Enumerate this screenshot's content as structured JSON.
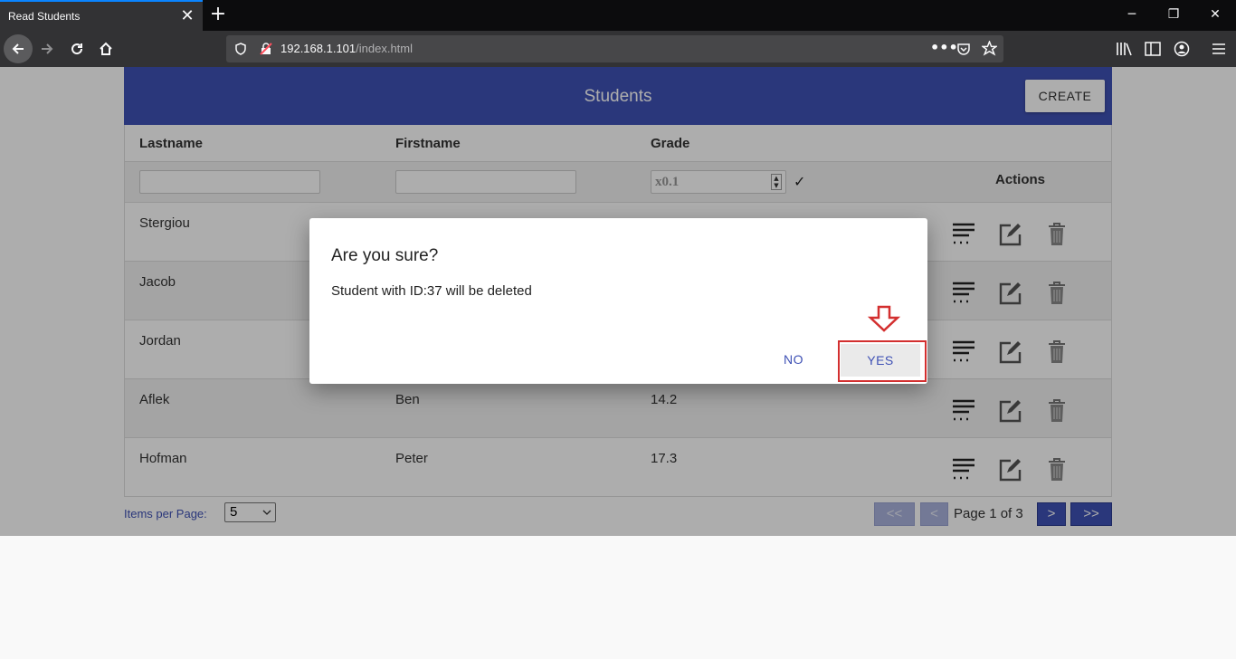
{
  "browser": {
    "tab_title": "Read Students",
    "url_host": "192.168.1.101",
    "url_path": "/index.html"
  },
  "app": {
    "title": "Students",
    "create_label": "CREATE"
  },
  "table": {
    "headers": {
      "lastname": "Lastname",
      "firstname": "Firstname",
      "grade": "Grade",
      "actions": "Actions"
    },
    "grade_placeholder": "x0.1",
    "rows": [
      {
        "lastname": "Stergiou",
        "firstname": "",
        "grade": ""
      },
      {
        "lastname": "Jacob",
        "firstname": "",
        "grade": ""
      },
      {
        "lastname": "Jordan",
        "firstname": "",
        "grade": ""
      },
      {
        "lastname": "Aflek",
        "firstname": "Ben",
        "grade": "14.2"
      },
      {
        "lastname": "Hofman",
        "firstname": "Peter",
        "grade": "17.3"
      }
    ]
  },
  "pager": {
    "items_per_page_label": "Items per Page:",
    "items_per_page_value": "5",
    "first": "<<",
    "prev": "<",
    "page_info": "Page 1 of 3",
    "next": ">",
    "last": ">>"
  },
  "dialog": {
    "title": "Are you sure?",
    "message": "Student with ID:37 will be deleted",
    "no_label": "NO",
    "yes_label": "YES"
  },
  "colors": {
    "primary": "#3f51b5",
    "highlight": "#d32f2f"
  }
}
